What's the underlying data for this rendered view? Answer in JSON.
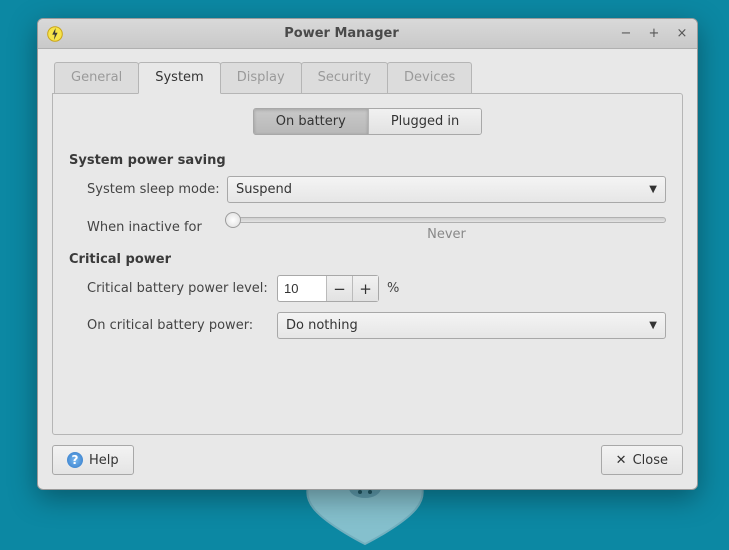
{
  "window": {
    "title": "Power Manager"
  },
  "tabs": {
    "general": "General",
    "system": "System",
    "display": "Display",
    "security": "Security",
    "devices": "Devices",
    "active": "system"
  },
  "power_source": {
    "on_battery": "On battery",
    "plugged_in": "Plugged in",
    "active": "on_battery"
  },
  "sections": {
    "system_power_saving": {
      "title": "System power saving",
      "sleep_mode_label": "System sleep mode:",
      "sleep_mode_value": "Suspend",
      "inactive_label": "When inactive for",
      "inactive_value_text": "Never"
    },
    "critical_power": {
      "title": "Critical power",
      "level_label": "Critical battery power level:",
      "level_value": "10",
      "level_unit": "%",
      "action_label": "On critical battery power:",
      "action_value": "Do nothing"
    }
  },
  "footer": {
    "help": "Help",
    "close": "Close"
  }
}
